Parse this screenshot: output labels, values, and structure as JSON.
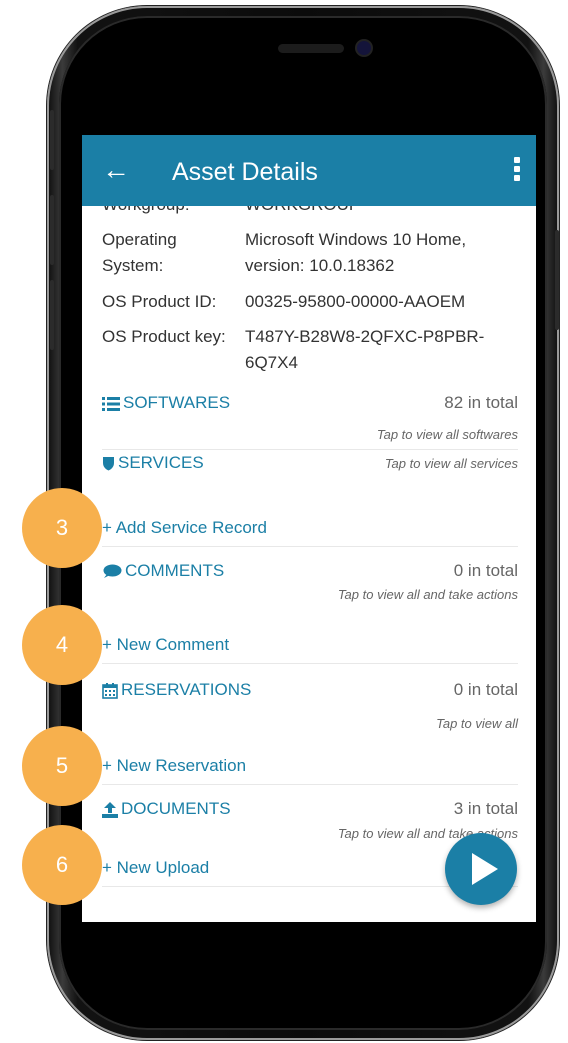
{
  "header": {
    "title": "Asset Details"
  },
  "details": [
    {
      "key": "Workgroup:",
      "value": "WORKGROUP"
    },
    {
      "key": "Operating System:",
      "value": "Microsoft Windows 10 Home, version: 10.0.18362"
    },
    {
      "key": "OS Product ID:",
      "value": "00325-95800-00000-AAOEM"
    },
    {
      "key": "OS Product key:",
      "value": "T487Y-B28W8-2QFXC-P8PBR-6Q7X4"
    }
  ],
  "softwares": {
    "label": "SOFTWARES",
    "total": "82 in total",
    "hint": "Tap to view all softwares"
  },
  "services": {
    "label": "SERVICES",
    "hint": "Tap to view all services",
    "action": "+ Add Service Record"
  },
  "comments": {
    "label": "COMMENTS",
    "total": "0 in total",
    "hint": "Tap to view all and take actions",
    "action": "+ New Comment"
  },
  "reservations": {
    "label": "RESERVATIONS",
    "total": "0 in total",
    "hint": "Tap to view all",
    "action": "+ New Reservation"
  },
  "documents": {
    "label": "DOCUMENTS",
    "total": "3 in total",
    "hint": "Tap to view all and take actions",
    "action": "+ New Upload"
  },
  "badges": [
    "3",
    "4",
    "5",
    "6"
  ],
  "colors": {
    "accent": "#1b7fa6",
    "badge": "#f7b04d"
  },
  "icons": [
    "back-arrow-icon",
    "more-vert-icon",
    "list-icon",
    "shield-icon",
    "comment-icon",
    "calendar-icon",
    "upload-icon",
    "play-icon"
  ]
}
